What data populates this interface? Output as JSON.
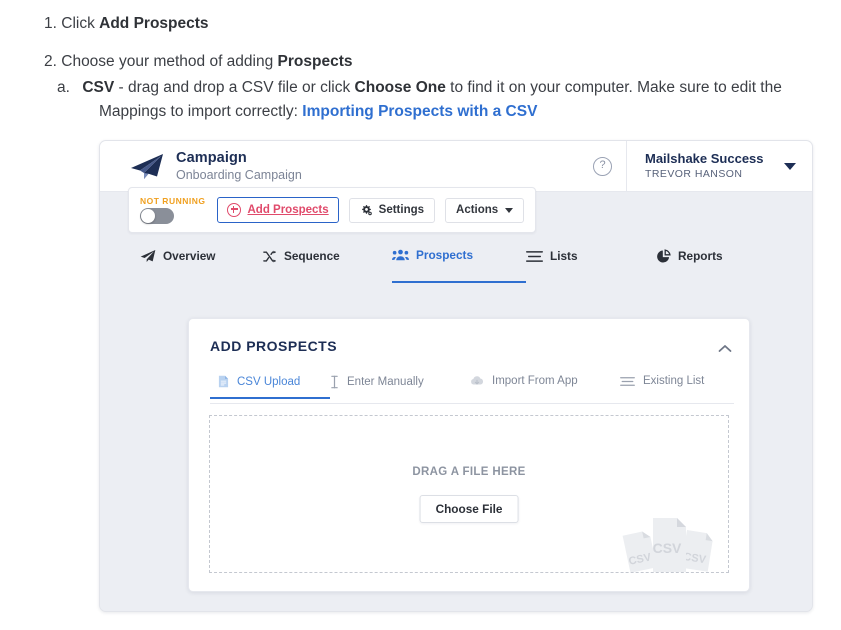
{
  "doc": {
    "item1": {
      "marker": "1.",
      "text_before": "Click ",
      "bold": "Add Prospects"
    },
    "item2": {
      "marker": "2.",
      "text_before": "Choose your method of adding ",
      "bold": "Prospects"
    },
    "item2a": {
      "marker": "a.",
      "bold1": "CSV",
      "text1": " - drag and drop a CSV file or click ",
      "bold2": "Choose One",
      "text2": " to find it on your computer. Make sure to edit the Mappings to import correctly: ",
      "link": "Importing Prospects with a CSV"
    },
    "colors": {
      "link": "#2f6fd0",
      "body": "#3c3f45"
    }
  },
  "app": {
    "header": {
      "logo_icon": "paper-plane-icon",
      "title": "Campaign",
      "subtitle": "Onboarding Campaign",
      "help_icon": "help-circle-icon",
      "account_name": "Mailshake Success",
      "account_user": "TREVOR HANSON",
      "account_caret_icon": "caret-down-icon"
    },
    "toolbar": {
      "status_label": "NOT RUNNING",
      "toggle_state": "off",
      "add_prospects_label": "Add Prospects",
      "add_prospects_icon": "plus-circle-icon",
      "settings_label": "Settings",
      "settings_icon": "gear-icon",
      "actions_label": "Actions",
      "actions_caret_icon": "caret-down-icon"
    },
    "nav_tabs": [
      {
        "label": "Overview",
        "icon": "paper-plane-icon",
        "active": false
      },
      {
        "label": "Sequence",
        "icon": "shuffle-icon",
        "active": false
      },
      {
        "label": "Prospects",
        "icon": "people-icon",
        "active": true
      },
      {
        "label": "Lists",
        "icon": "list-lines-icon",
        "active": false
      },
      {
        "label": "Reports",
        "icon": "pie-chart-icon",
        "active": false
      }
    ],
    "panel": {
      "title": "ADD PROSPECTS",
      "collapse_icon": "chevron-up-icon",
      "tabs": [
        {
          "label": "CSV Upload",
          "icon": "file-document-icon",
          "active": true
        },
        {
          "label": "Enter Manually",
          "icon": "text-cursor-icon",
          "active": false
        },
        {
          "label": "Import From App",
          "icon": "cloud-download-icon",
          "active": false
        },
        {
          "label": "Existing List",
          "icon": "list-lines-icon",
          "active": false
        }
      ],
      "dropzone": {
        "drag_text": "DRAG A FILE HERE",
        "choose_button": "Choose File",
        "illustration_icon": "csv-files-icon",
        "illustration_label": "CSV"
      }
    },
    "colors": {
      "accent_blue": "#2f6fd0",
      "navy": "#1d2e55",
      "status_orange": "#f0a020",
      "link_red": "#e04a6b",
      "body_bg": "#eceef3"
    }
  }
}
